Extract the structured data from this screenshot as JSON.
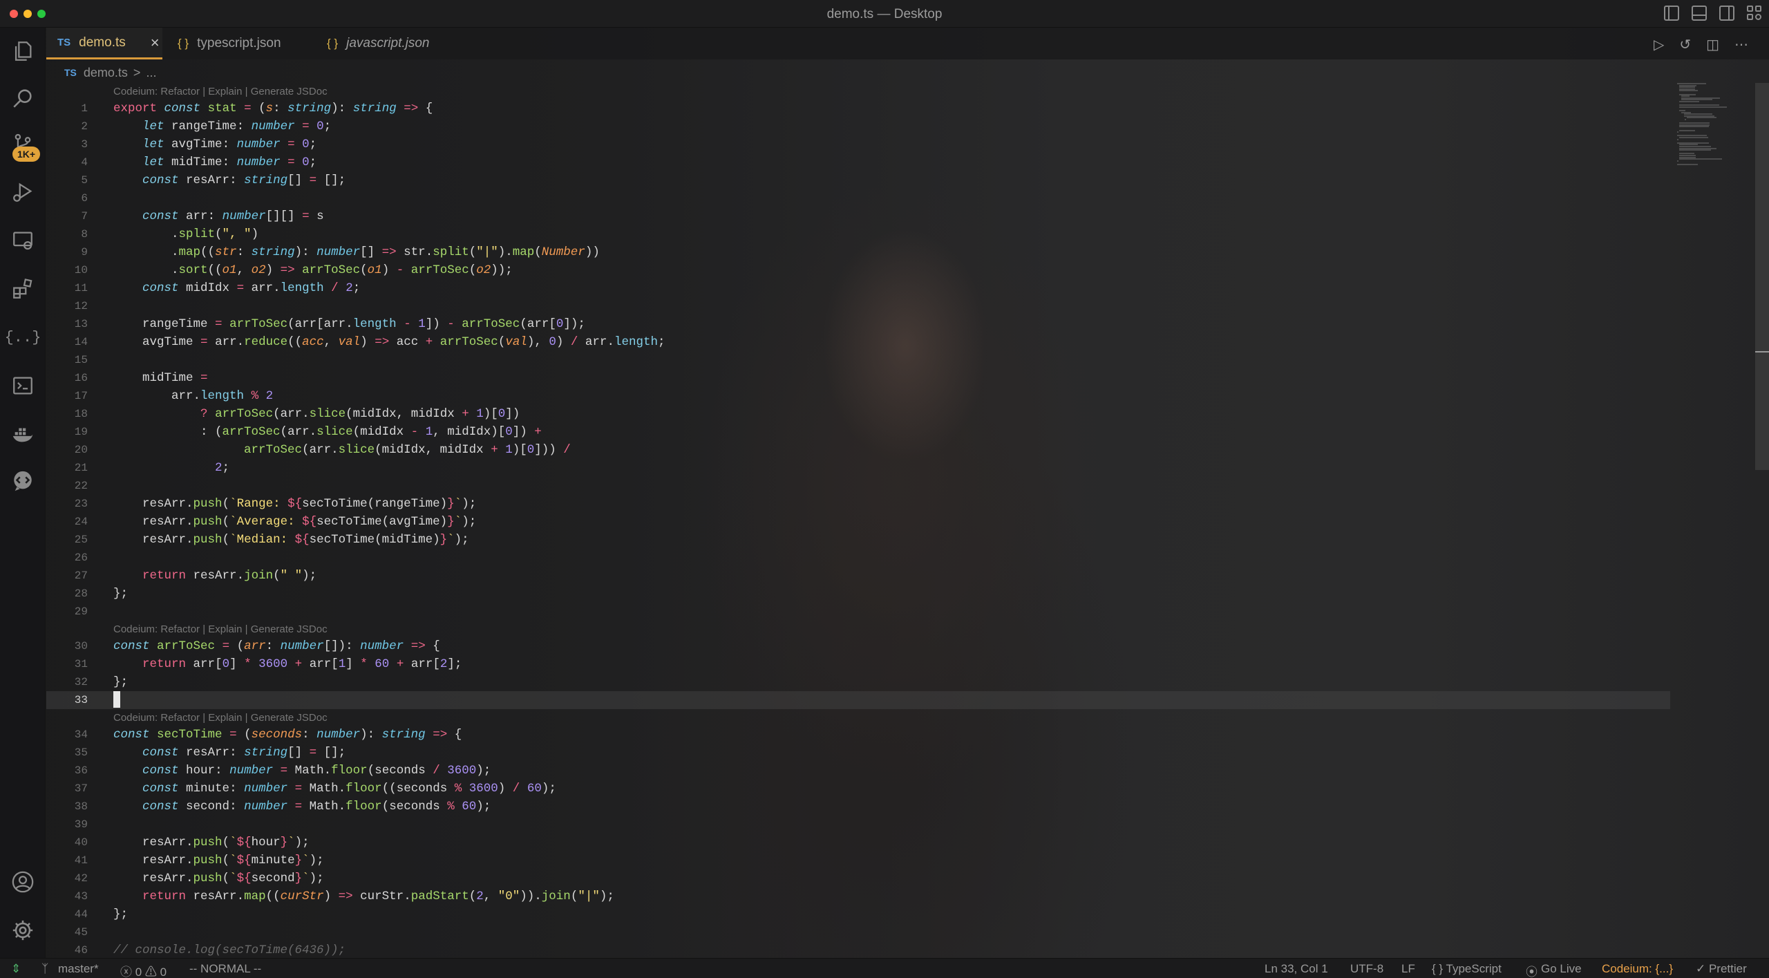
{
  "window": {
    "title": "demo.ts — Desktop"
  },
  "activity": {
    "badge": "1K+"
  },
  "tabs": [
    {
      "label": "demo.ts",
      "icon": "TS",
      "active": true,
      "close": "×"
    },
    {
      "label": "typescript.json",
      "icon": "{ }"
    },
    {
      "label": "javascript.json",
      "icon": "{ }"
    }
  ],
  "breadcrumb": {
    "icon": "TS",
    "file": "demo.ts",
    "sep": ">",
    "rest": "..."
  },
  "codelens": "Codeium: Refactor | Explain | Generate JSDoc",
  "editor": {
    "current_line": 33,
    "lines": [
      {
        "n": "1",
        "code": "export const stat = (s: string): string => {"
      },
      {
        "n": "2",
        "code": "    let rangeTime: number = 0;"
      },
      {
        "n": "3",
        "code": "    let avgTime: number = 0;"
      },
      {
        "n": "4",
        "code": "    let midTime: number = 0;"
      },
      {
        "n": "5",
        "code": "    const resArr: string[] = [];"
      },
      {
        "n": "6",
        "code": ""
      },
      {
        "n": "7",
        "code": "    const arr: number[][] = s"
      },
      {
        "n": "8",
        "code": "        .split(\", \")"
      },
      {
        "n": "9",
        "code": "        .map((str: string): number[] => str.split(\"|\").map(Number))"
      },
      {
        "n": "10",
        "code": "        .sort((o1, o2) => arrToSec(o1) - arrToSec(o2));"
      },
      {
        "n": "11",
        "code": "    const midIdx = arr.length / 2;"
      },
      {
        "n": "12",
        "code": ""
      },
      {
        "n": "13",
        "code": "    rangeTime = arrToSec(arr[arr.length - 1]) - arrToSec(arr[0]);"
      },
      {
        "n": "14",
        "code": "    avgTime = arr.reduce((acc, val) => acc + arrToSec(val), 0) / arr.length;"
      },
      {
        "n": "15",
        "code": ""
      },
      {
        "n": "16",
        "code": "    midTime ="
      },
      {
        "n": "17",
        "code": "        arr.length % 2"
      },
      {
        "n": "18",
        "code": "            ? arrToSec(arr.slice(midIdx, midIdx + 1)[0])"
      },
      {
        "n": "19",
        "code": "            : (arrToSec(arr.slice(midIdx - 1, midIdx)[0]) +"
      },
      {
        "n": "20",
        "code": "                  arrToSec(arr.slice(midIdx, midIdx + 1)[0])) /"
      },
      {
        "n": "21",
        "code": "              2;"
      },
      {
        "n": "22",
        "code": ""
      },
      {
        "n": "23",
        "code": "    resArr.push(`Range: ${secToTime(rangeTime)}`);"
      },
      {
        "n": "24",
        "code": "    resArr.push(`Average: ${secToTime(avgTime)}`);"
      },
      {
        "n": "25",
        "code": "    resArr.push(`Median: ${secToTime(midTime)}`);"
      },
      {
        "n": "26",
        "code": ""
      },
      {
        "n": "27",
        "code": "    return resArr.join(\" \");"
      },
      {
        "n": "28",
        "code": "};"
      },
      {
        "n": "29",
        "code": ""
      },
      {
        "n": "30",
        "code": "const arrToSec = (arr: number[]): number => {"
      },
      {
        "n": "31",
        "code": "    return arr[0] * 3600 + arr[1] * 60 + arr[2];"
      },
      {
        "n": "32",
        "code": "};"
      },
      {
        "n": "33",
        "code": ""
      },
      {
        "n": "34",
        "code": "const secToTime = (seconds: number): string => {"
      },
      {
        "n": "35",
        "code": "    const resArr: string[] = [];"
      },
      {
        "n": "36",
        "code": "    const hour: number = Math.floor(seconds / 3600);"
      },
      {
        "n": "37",
        "code": "    const minute: number = Math.floor((seconds % 3600) / 60);"
      },
      {
        "n": "38",
        "code": "    const second: number = Math.floor(seconds % 60);"
      },
      {
        "n": "39",
        "code": ""
      },
      {
        "n": "40",
        "code": "    resArr.push(`${hour}`);"
      },
      {
        "n": "41",
        "code": "    resArr.push(`${minute}`);"
      },
      {
        "n": "42",
        "code": "    resArr.push(`${second}`);"
      },
      {
        "n": "43",
        "code": "    return resArr.map((curStr) => curStr.padStart(2, \"0\")).join(\"|\");"
      },
      {
        "n": "44",
        "code": "};"
      },
      {
        "n": "45",
        "code": ""
      },
      {
        "n": "46",
        "code": "// console.log(secToTime(6436));"
      }
    ]
  },
  "status": {
    "branch": "master*",
    "problems": "ⓧ 0 ⚠ 0",
    "mode": "-- NORMAL --",
    "position": "Ln 33, Col 1",
    "encoding": "UTF-8",
    "eol": "LF",
    "language": "{ } TypeScript",
    "golive": "Go Live",
    "codeium": "Codeium: {...}",
    "prettier": "✓ Prettier"
  },
  "colors": {
    "accent": "#d99a3a",
    "background": "#1b1b1c",
    "badge": "#e2a33a"
  }
}
